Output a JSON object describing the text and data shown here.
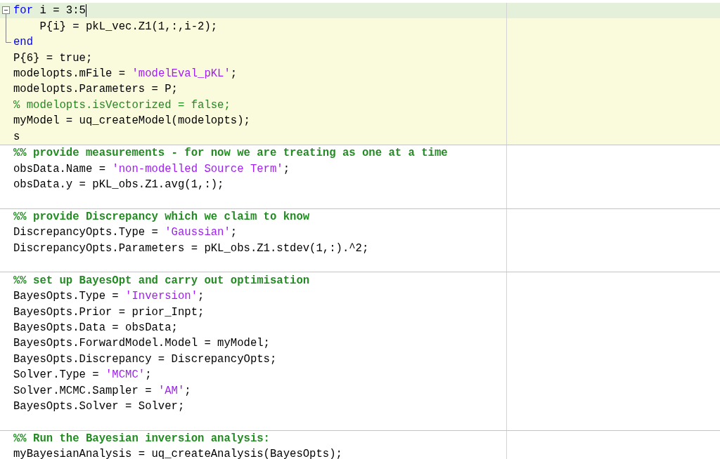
{
  "cells": [
    {
      "active": true,
      "lines": [
        {
          "kind": "foldstart",
          "current": true,
          "cursor": true,
          "tokens": [
            {
              "kind": "keyword",
              "text": "for"
            },
            {
              "kind": "plain",
              "text": " i = 3:5"
            }
          ]
        },
        {
          "kind": "foldbody",
          "tokens": [
            {
              "kind": "plain",
              "text": "    P{i} = pkL_vec.Z1(1,:,i-2);"
            }
          ]
        },
        {
          "kind": "foldend",
          "tokens": [
            {
              "kind": "keyword",
              "text": "end"
            }
          ]
        },
        {
          "kind": "code",
          "tokens": [
            {
              "kind": "plain",
              "text": "P{6} = true;"
            }
          ]
        },
        {
          "kind": "code",
          "tokens": [
            {
              "kind": "plain",
              "text": "modelopts.mFile = "
            },
            {
              "kind": "string",
              "text": "'modelEval_pKL'"
            },
            {
              "kind": "plain",
              "text": ";"
            }
          ]
        },
        {
          "kind": "code",
          "tokens": [
            {
              "kind": "plain",
              "text": "modelopts.Parameters = P;"
            }
          ]
        },
        {
          "kind": "code",
          "tokens": [
            {
              "kind": "comment",
              "text": "% modelopts.isVectorized = false;"
            }
          ]
        },
        {
          "kind": "code",
          "tokens": [
            {
              "kind": "plain",
              "text": "myModel = uq_createModel(modelopts);"
            }
          ]
        },
        {
          "kind": "code",
          "tokens": [
            {
              "kind": "plain",
              "text": "s"
            }
          ]
        }
      ]
    },
    {
      "active": false,
      "lines": [
        {
          "kind": "code",
          "tokens": [
            {
              "kind": "section",
              "text": "%% provide measurements - for now we are treating as one at a time"
            }
          ]
        },
        {
          "kind": "code",
          "tokens": [
            {
              "kind": "plain",
              "text": "obsData.Name = "
            },
            {
              "kind": "string",
              "text": "'non-modelled Source Term'"
            },
            {
              "kind": "plain",
              "text": ";"
            }
          ]
        },
        {
          "kind": "code",
          "tokens": [
            {
              "kind": "plain",
              "text": "obsData.y = pKL_obs.Z1.avg(1,:);"
            }
          ]
        },
        {
          "kind": "blank"
        }
      ]
    },
    {
      "active": false,
      "lines": [
        {
          "kind": "code",
          "tokens": [
            {
              "kind": "section",
              "text": "%% provide Discrepancy which we claim to know"
            }
          ]
        },
        {
          "kind": "code",
          "tokens": [
            {
              "kind": "plain",
              "text": "DiscrepancyOpts.Type = "
            },
            {
              "kind": "string",
              "text": "'Gaussian'"
            },
            {
              "kind": "plain",
              "text": ";"
            }
          ]
        },
        {
          "kind": "code",
          "tokens": [
            {
              "kind": "plain",
              "text": "DiscrepancyOpts.Parameters = pKL_obs.Z1.stdev(1,:).^2;"
            }
          ]
        },
        {
          "kind": "blank"
        }
      ]
    },
    {
      "active": false,
      "lines": [
        {
          "kind": "code",
          "tokens": [
            {
              "kind": "section",
              "text": "%% set up BayesOpt and carry out optimisation"
            }
          ]
        },
        {
          "kind": "code",
          "tokens": [
            {
              "kind": "plain",
              "text": "BayesOpts.Type = "
            },
            {
              "kind": "string",
              "text": "'Inversion'"
            },
            {
              "kind": "plain",
              "text": ";"
            }
          ]
        },
        {
          "kind": "code",
          "tokens": [
            {
              "kind": "plain",
              "text": "BayesOpts.Prior = prior_Inpt;"
            }
          ]
        },
        {
          "kind": "code",
          "tokens": [
            {
              "kind": "plain",
              "text": "BayesOpts.Data = obsData;"
            }
          ]
        },
        {
          "kind": "code",
          "tokens": [
            {
              "kind": "plain",
              "text": "BayesOpts.ForwardModel.Model = myModel;"
            }
          ]
        },
        {
          "kind": "code",
          "tokens": [
            {
              "kind": "plain",
              "text": "BayesOpts.Discrepancy = DiscrepancyOpts;"
            }
          ]
        },
        {
          "kind": "code",
          "tokens": [
            {
              "kind": "plain",
              "text": "Solver.Type = "
            },
            {
              "kind": "string",
              "text": "'MCMC'"
            },
            {
              "kind": "plain",
              "text": ";"
            }
          ]
        },
        {
          "kind": "code",
          "tokens": [
            {
              "kind": "plain",
              "text": "Solver.MCMC.Sampler = "
            },
            {
              "kind": "string",
              "text": "'AM'"
            },
            {
              "kind": "plain",
              "text": ";"
            }
          ]
        },
        {
          "kind": "code",
          "tokens": [
            {
              "kind": "plain",
              "text": "BayesOpts.Solver = Solver;"
            }
          ]
        },
        {
          "kind": "blank"
        }
      ]
    },
    {
      "active": false,
      "lines": [
        {
          "kind": "code",
          "tokens": [
            {
              "kind": "section",
              "text": "%% Run the Bayesian inversion analysis:"
            }
          ]
        },
        {
          "kind": "code",
          "tokens": [
            {
              "kind": "plain",
              "text": "myBayesianAnalysis = uq_createAnalysis(BayesOpts);"
            }
          ]
        }
      ]
    }
  ]
}
